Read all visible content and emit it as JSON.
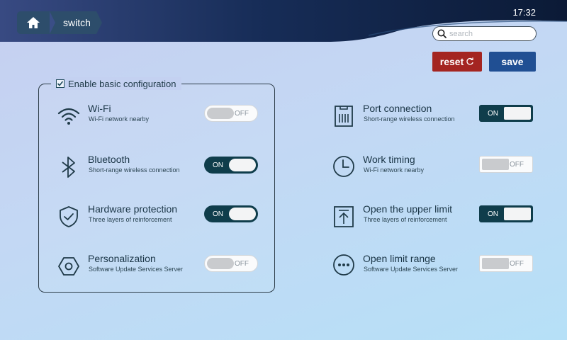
{
  "header": {
    "breadcrumb": "switch",
    "time": "17:32",
    "search_placeholder": "search",
    "home_icon": "home-icon",
    "search_icon": "search-icon"
  },
  "actions": {
    "reset_label": "reset",
    "reset_icon": "refresh-icon",
    "save_label": "save",
    "reset_color": "#a42521",
    "save_color": "#204f93"
  },
  "panel": {
    "legend": "Enable basic configuration",
    "checked": true
  },
  "left_items": [
    {
      "title": "Wi-Fi",
      "subtitle": "Wi-Fi network nearby",
      "icon": "wifi-icon",
      "state": "OFF"
    },
    {
      "title": "Bluetooth",
      "subtitle": "Short-range wireless connection",
      "icon": "bluetooth-icon",
      "state": "ON"
    },
    {
      "title": "Hardware protection",
      "subtitle": "Three layers of reinforcement",
      "icon": "shield-icon",
      "state": "ON"
    },
    {
      "title": "Personalization",
      "subtitle": "Software Update Services Server",
      "icon": "hexagon-icon",
      "state": "OFF"
    }
  ],
  "right_items": [
    {
      "title": "Port connection",
      "subtitle": "Short-range wireless connection",
      "icon": "ethernet-port-icon",
      "state": "ON"
    },
    {
      "title": "Work timing",
      "subtitle": "Wi-Fi network nearby",
      "icon": "clock-icon",
      "state": "OFF"
    },
    {
      "title": "Open the upper limit",
      "subtitle": "Three layers of reinforcement",
      "icon": "upload-icon",
      "state": "ON"
    },
    {
      "title": "Open limit range",
      "subtitle": "Software Update Services Server",
      "icon": "more-icon",
      "state": "OFF"
    }
  ],
  "colors": {
    "toggle_on": "#0f3d4b",
    "header_dark": "#0d1f3c",
    "accent": "#2d4d6b"
  }
}
